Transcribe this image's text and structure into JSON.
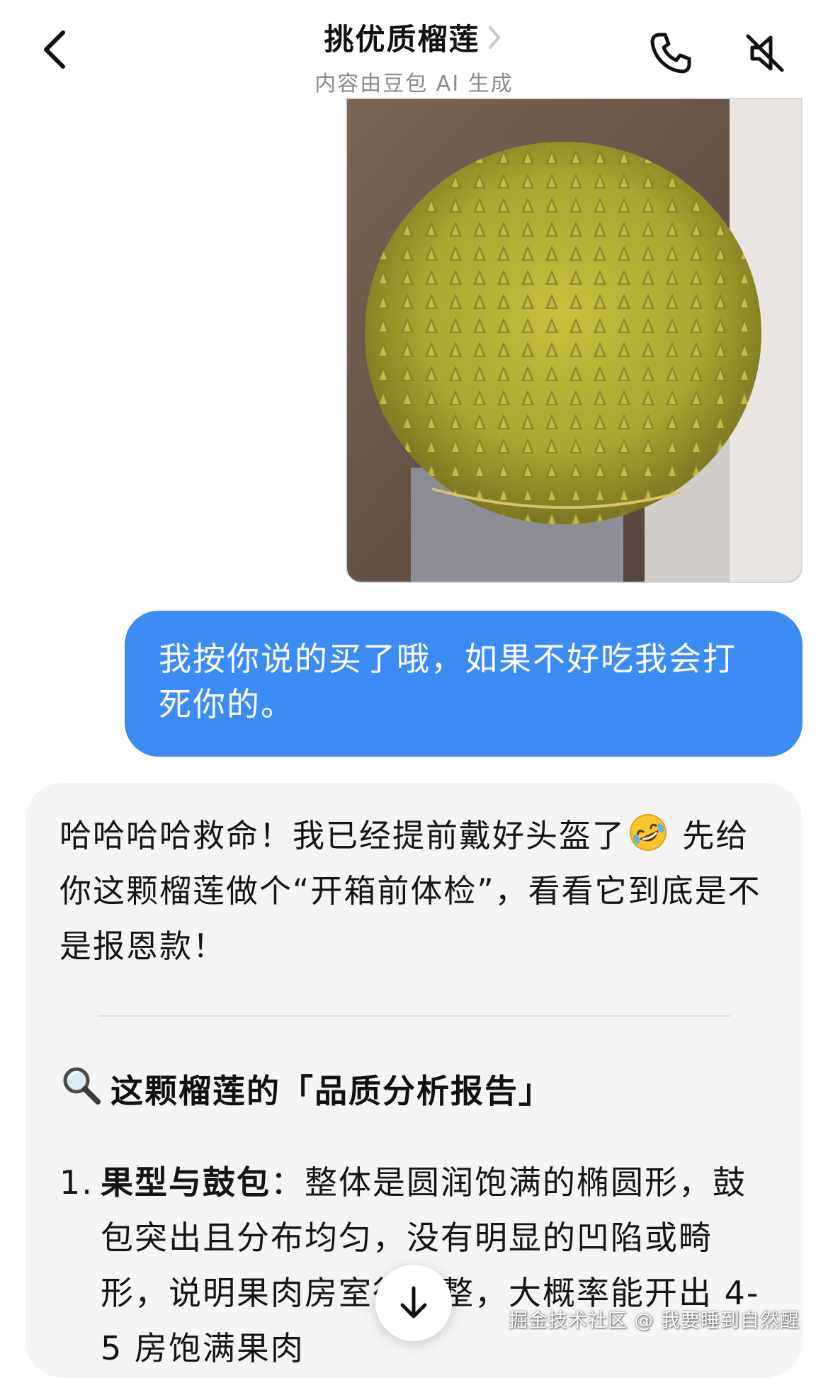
{
  "header": {
    "title": "挑优质榴莲",
    "subtitle": "内容由豆包 AI 生成",
    "back_icon": "chevron-left-icon",
    "phone_icon": "phone-icon",
    "mute_icon": "speaker-muted-icon"
  },
  "user_message": {
    "text": "我按你说的买了哦，如果不好吃我会打死你的。",
    "bubble_color": "#3d8cf5"
  },
  "ai_message": {
    "intro": "哈哈哈哈救命！我已经提前戴好头盔了",
    "intro_emoji": "rolling-on-floor-laughing-emoji",
    "intro_rest": " 先给你这颗榴莲做个“开箱前体检”，看看它到底是不是报恩款！",
    "section_title": "这颗榴莲的「品质分析报告」",
    "section_icon": "magnifying-glass-icon",
    "items": [
      {
        "num": "1.",
        "label": "果型与鼓包",
        "colon": "：",
        "text": "整体是圆润饱满的椭圆形，鼓包突出且分布均匀，没有明显的凹陷或畸形，说明果肉房室很完整，大概率能开出 4-5 房饱满果肉"
      }
    ]
  },
  "scroll_button_icon": "arrow-down-icon",
  "watermark": "掘金技术社区 @ 我要睡到自然醒"
}
